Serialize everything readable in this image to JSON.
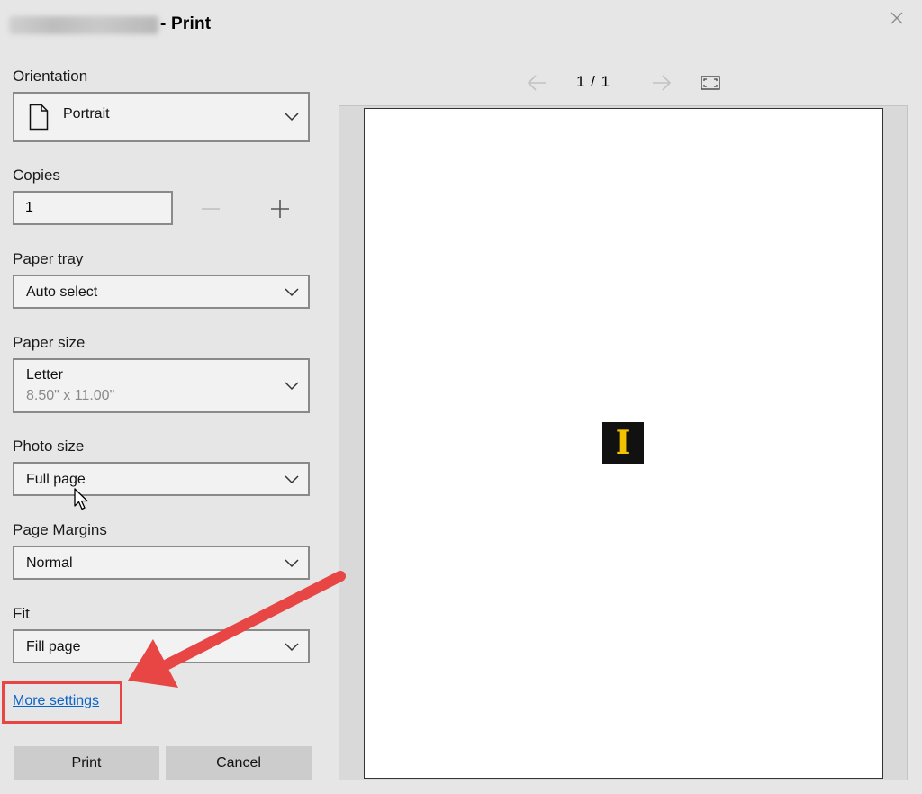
{
  "window": {
    "title_suffix": "- Print"
  },
  "settings": {
    "orientation": {
      "label": "Orientation",
      "value": "Portrait"
    },
    "copies": {
      "label": "Copies",
      "value": "1"
    },
    "paper_tray": {
      "label": "Paper tray",
      "value": "Auto select"
    },
    "paper_size": {
      "label": "Paper size",
      "value": "Letter",
      "sub": "8.50\" x 11.00\""
    },
    "photo_size": {
      "label": "Photo size",
      "value": "Full page"
    },
    "page_margins": {
      "label": "Page Margins",
      "value": "Normal"
    },
    "fit": {
      "label": "Fit",
      "value": "Fill page"
    }
  },
  "links": {
    "more_settings": "More settings"
  },
  "buttons": {
    "print": "Print",
    "cancel": "Cancel"
  },
  "preview": {
    "page_counter": "1 / 1",
    "thumbnail_letter": "I"
  },
  "colors": {
    "accent_link": "#0a63c9",
    "annotation_red": "#e84545",
    "thumb_yellow": "#f2c200"
  }
}
